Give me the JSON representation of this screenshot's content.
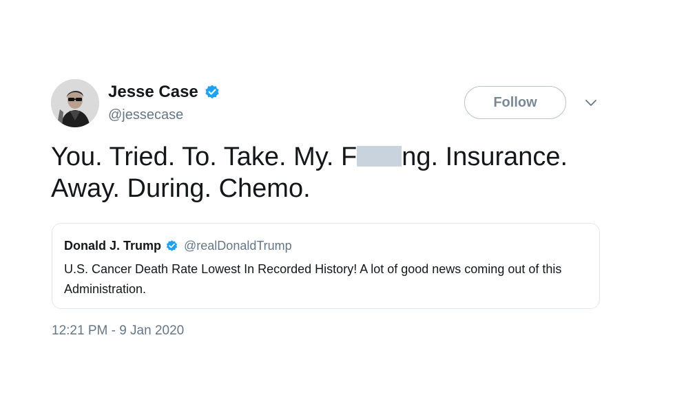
{
  "tweet": {
    "author": {
      "name": "Jesse Case",
      "handle": "@jessecase",
      "verified": true,
      "avatar_icon": "user-avatar-photo"
    },
    "follow_label": "Follow",
    "text_lines": [
      {
        "before": "You. Tried. To. Take. My. F",
        "redacted": true,
        "after": "ng. Insurance."
      },
      {
        "before": "Away. During. Chemo.",
        "redacted": false,
        "after": ""
      }
    ],
    "quoted": {
      "name": "Donald J. Trump",
      "handle": "@realDonaldTrump",
      "verified": true,
      "text": "U.S. Cancer Death Rate Lowest In Recorded History! A lot of good news coming out of this Administration."
    },
    "timestamp": "12:21 PM - 9 Jan 2020"
  },
  "colors": {
    "verified_blue": "#1da1f2",
    "secondary_text": "#657786",
    "border": "#e1e8ed",
    "redaction": "#c9d3dd"
  }
}
